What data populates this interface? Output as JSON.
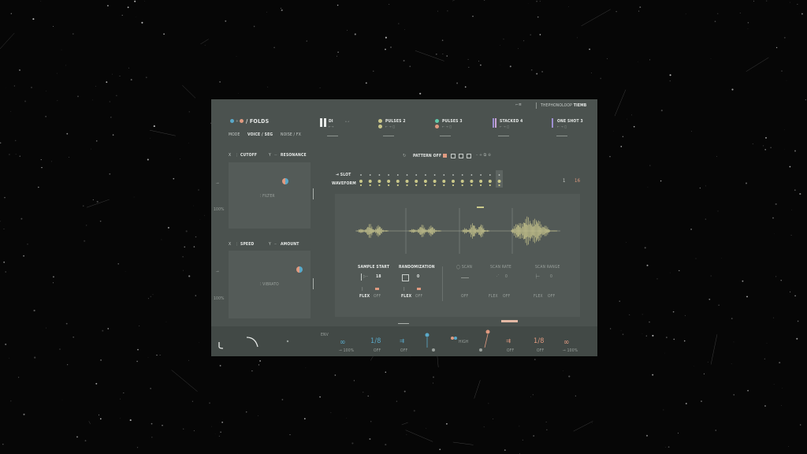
{
  "header": {
    "preset_name": "/ FOLDS",
    "brand": "THEPHONOLOOP",
    "brand_suffix": "TIEMB",
    "nav_tabs": [
      "MODE",
      "VOICE / SEG",
      "NOISE / FX"
    ],
    "active_tab": "VOICE / SEG",
    "colors": {
      "blue": "#5aa9c9",
      "salmon": "#e09a80",
      "green": "#5fc9a9",
      "yellow": "#c9c58a",
      "purple": "#9d8fd0",
      "lilac": "#c9a3d8"
    }
  },
  "slots": [
    {
      "name": "DI"
    },
    {
      "name": "PULSES 2"
    },
    {
      "name": "PULSES 3"
    },
    {
      "name": "STACKED 4"
    },
    {
      "name": "ONE SHOT 3"
    }
  ],
  "xy_pads": [
    {
      "x_label": "X",
      "x_param": "CUTOFF",
      "y_label": "Y",
      "y_param": "RESONANCE",
      "center_label": "FILTER",
      "percent": "100%"
    },
    {
      "x_label": "X",
      "x_param": "SPEED",
      "y_label": "Y",
      "y_param": "AMOUNT",
      "center_label": "VIBRATO",
      "percent": "100%"
    }
  ],
  "pattern": {
    "label": "PATTERN OFF"
  },
  "sequencer": {
    "slot_label": "SLOT",
    "waveform_label": "WAVEFORM",
    "count_a": "1",
    "count_b": "16"
  },
  "controls": {
    "sample_start": {
      "label": "SAMPLE START",
      "value": "18",
      "mode_a": "FLEX",
      "mode_b": "OFF"
    },
    "randomization": {
      "label": "RANDOMIZATION",
      "value": "0",
      "mode_a": "FLEX",
      "mode_b": "OFF"
    },
    "scan": {
      "label": "SCAN",
      "mode": "OFF"
    },
    "scan_rate": {
      "label": "SCAN RATE",
      "value": "0",
      "mode_a": "FLEX",
      "mode_b": "OFF"
    },
    "scan_range": {
      "label": "SCAN RANGE",
      "value": "0",
      "mode_a": "FLEX",
      "mode_b": "OFF"
    }
  },
  "footer": {
    "env_label": "ENV",
    "left_inf_pct": "100%",
    "left_rate": "1/8",
    "left_rate_sub": "OFF",
    "left_arrow_sub": "OFF",
    "right_rate": "1/8",
    "right_rate_sub": "OFF",
    "right_arrow_sub": "OFF",
    "right_inf_pct": "100%"
  }
}
